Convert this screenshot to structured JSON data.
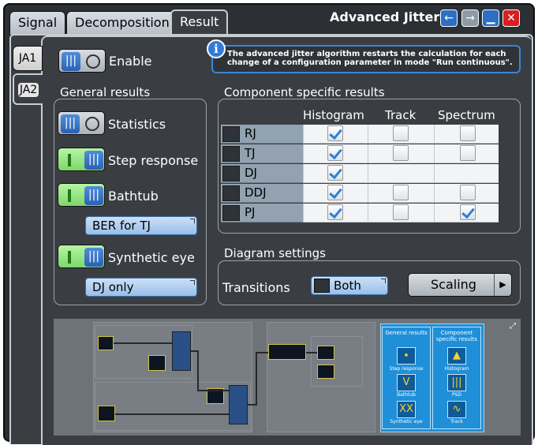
{
  "tabs": [
    {
      "label": "Signal"
    },
    {
      "label": "Decomposition"
    },
    {
      "label": "Result",
      "active": true
    }
  ],
  "window": {
    "title": "Advanced Jitter",
    "buttons": [
      "back-icon",
      "forward-icon",
      "minimize-icon",
      "close-icon"
    ]
  },
  "side_tabs": [
    {
      "label": "JA1"
    },
    {
      "label": "JA2",
      "active": true
    }
  ],
  "enable": {
    "label": "Enable",
    "state": "off"
  },
  "info_message": "The advanced jitter algorithm restarts the calculation for each change of a configuration parameter in mode \"Run continuous\".",
  "general_results": {
    "title": "General results",
    "items": [
      {
        "label": "Statistics",
        "state": "off"
      },
      {
        "label": "Step response",
        "state": "on"
      },
      {
        "label": "Bathtub",
        "state": "on"
      },
      {
        "label": "Synthetic eye",
        "state": "on"
      }
    ],
    "bathtub_dropdown": "BER for TJ",
    "synthetic_eye_dropdown": "DJ only"
  },
  "component_results": {
    "title": "Component specific results",
    "columns": [
      "Histogram",
      "Track",
      "Spectrum"
    ],
    "rows": [
      {
        "name": "RJ",
        "histogram": true,
        "track": false,
        "spectrum": false
      },
      {
        "name": "TJ",
        "histogram": true,
        "track": false,
        "spectrum": false
      },
      {
        "name": "DJ",
        "histogram": true,
        "track": null,
        "spectrum": null
      },
      {
        "name": "DDJ",
        "histogram": true,
        "track": false,
        "spectrum": false
      },
      {
        "name": "PJ",
        "histogram": true,
        "track": false,
        "spectrum": true
      }
    ]
  },
  "diagram_settings": {
    "title": "Diagram settings",
    "transitions_label": "Transitions",
    "transitions_value": "Both",
    "scaling_label": "Scaling"
  },
  "overview": {
    "general_panel": {
      "title": "General results",
      "items": [
        "Step response",
        "Bathtub",
        "Synthetic eye"
      ]
    },
    "component_panel": {
      "title": "Component specific results",
      "items": [
        "Histogram",
        "PSD",
        "Track"
      ]
    }
  },
  "colors": {
    "accent_blue": "#2e7fd7",
    "toggle_on": "#7ed66a",
    "close_red": "#d71f1f",
    "panel_bg": "#3a3e43"
  }
}
